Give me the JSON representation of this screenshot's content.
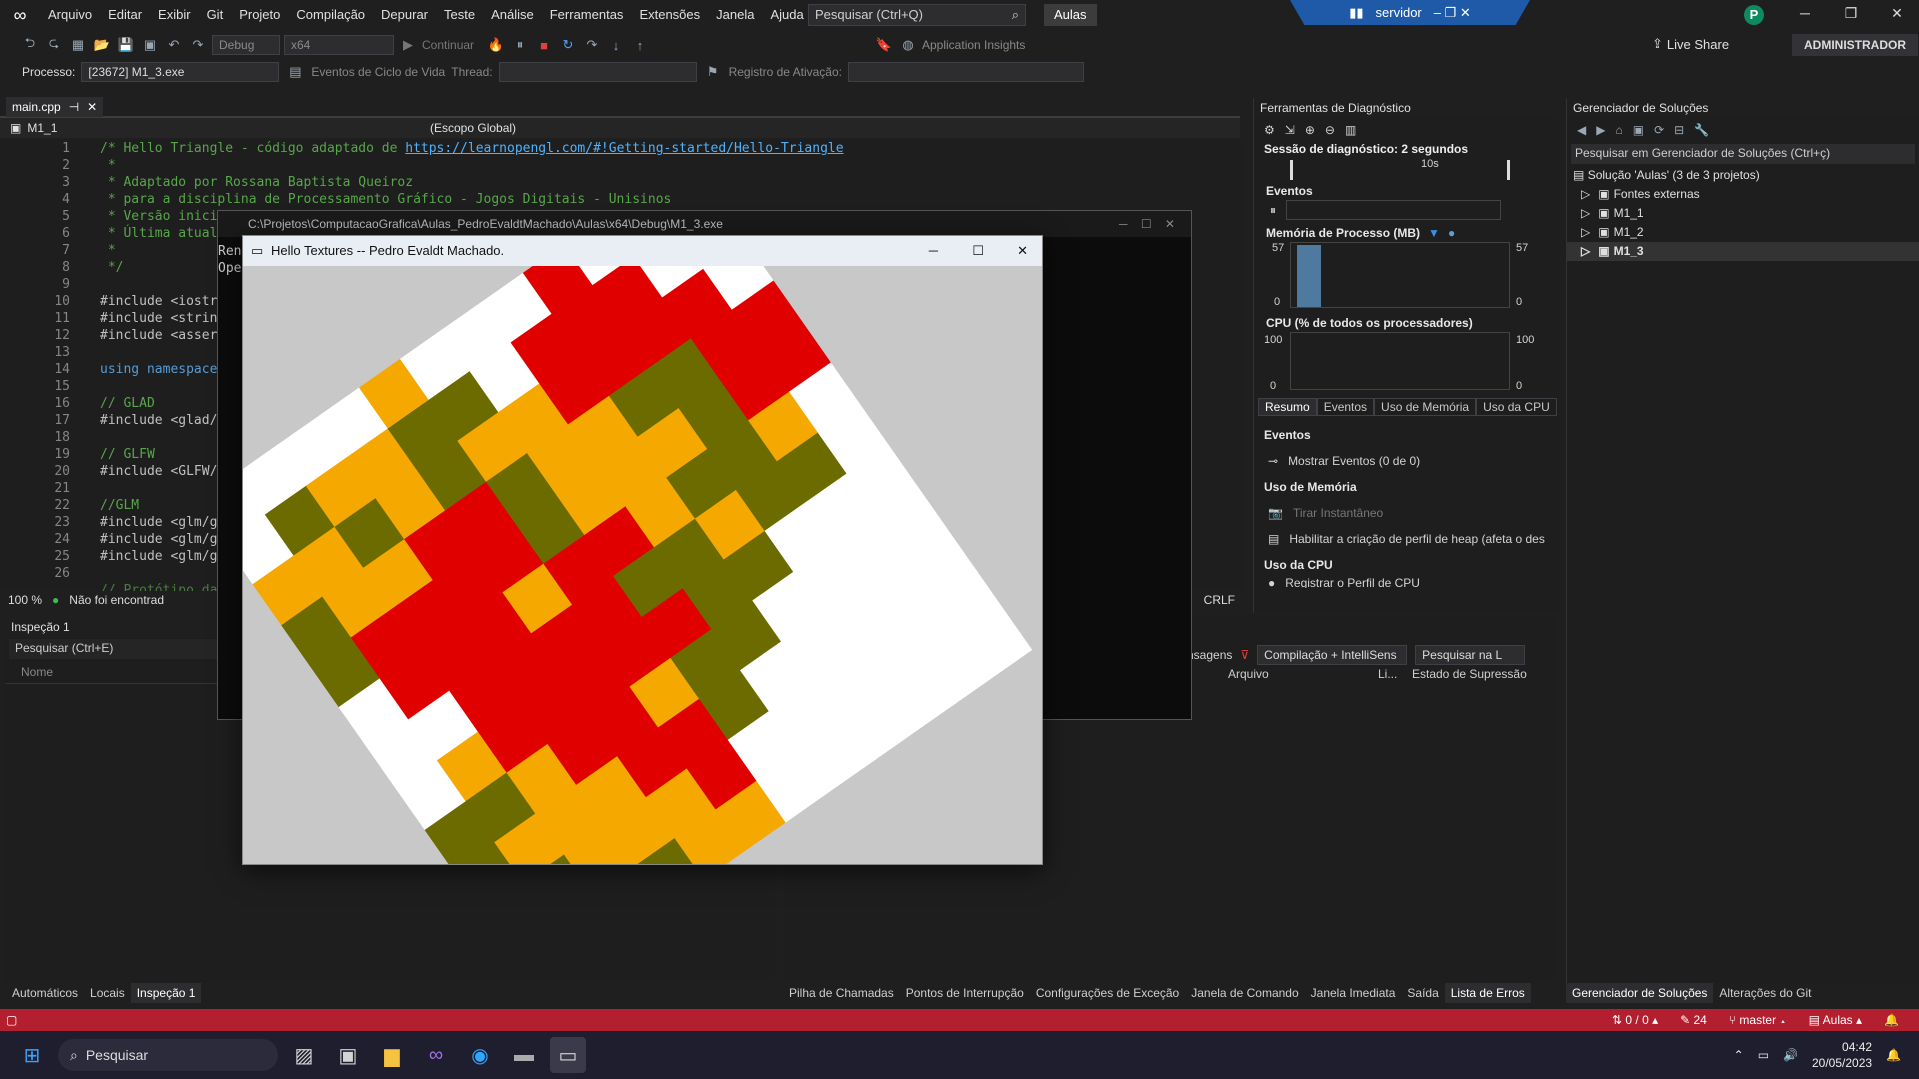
{
  "menubar": {
    "items": [
      "Arquivo",
      "Editar",
      "Exibir",
      "Git",
      "Projeto",
      "Compilação",
      "Depurar",
      "Teste",
      "Análise",
      "Ferramentas",
      "Extensões",
      "Janela",
      "Ajuda"
    ],
    "search_placeholder": "Pesquisar (Ctrl+Q)",
    "solution_name": "Aulas",
    "remote": "servidor",
    "avatar": "P"
  },
  "toolbar": {
    "config": "Debug",
    "platform": "x64",
    "continue": "Continuar",
    "app_insights": "Application Insights",
    "live_share": "Live Share",
    "admin": "ADMINISTRADOR",
    "process_label": "Processo:",
    "process_value": "[23672] M1_3.exe",
    "lifecycle": "Eventos de Ciclo de Vida",
    "thread_label": "Thread:",
    "activation_label": "Registro de Ativação:"
  },
  "editor": {
    "tab": "main.cpp",
    "project": "M1_1",
    "scope": "(Escopo Global)",
    "line_numbers": [
      "1",
      "2",
      "3",
      "4",
      "5",
      "6",
      "7",
      "8",
      "9",
      "10",
      "11",
      "12",
      "13",
      "14",
      "15",
      "16",
      "17",
      "18",
      "19",
      "20",
      "21",
      "22",
      "23",
      "24",
      "25",
      "26"
    ],
    "lines": [
      {
        "text": "/* Hello Triangle - código adaptado de ",
        "cls": "c-comment",
        "link": "https://learnopengl.com/#!Getting-started/Hello-Triangle"
      },
      {
        "text": " *",
        "cls": "c-comment"
      },
      {
        "text": " * Adaptado por Rossana Baptista Queiroz",
        "cls": "c-comment"
      },
      {
        "text": " * para a disciplina de Processamento Gráfico - Jogos Digitais - Unisinos",
        "cls": "c-comment"
      },
      {
        "text": " * Versão inici",
        "cls": "c-comment"
      },
      {
        "text": " * Última atual",
        "cls": "c-comment"
      },
      {
        "text": " *",
        "cls": "c-comment"
      },
      {
        "text": " */",
        "cls": "c-comment"
      },
      {
        "text": "",
        "cls": "c-pp"
      },
      {
        "text": "#include <iostr",
        "cls": "c-pp"
      },
      {
        "text": "#include <strin",
        "cls": "c-pp"
      },
      {
        "text": "#include <asser",
        "cls": "c-pp"
      },
      {
        "text": "",
        "cls": "c-pp"
      },
      {
        "text": "using namespace",
        "cls": "c-kw"
      },
      {
        "text": "",
        "cls": "c-pp"
      },
      {
        "text": "// GLAD",
        "cls": "c-comment"
      },
      {
        "text": "#include <glad/",
        "cls": "c-pp"
      },
      {
        "text": "",
        "cls": "c-pp"
      },
      {
        "text": "// GLFW",
        "cls": "c-comment"
      },
      {
        "text": "#include <GLFW/",
        "cls": "c-pp"
      },
      {
        "text": "",
        "cls": "c-pp"
      },
      {
        "text": "//GLM",
        "cls": "c-comment"
      },
      {
        "text": "#include <glm/g",
        "cls": "c-pp"
      },
      {
        "text": "#include <glm/g",
        "cls": "c-pp"
      },
      {
        "text": "#include <glm/g",
        "cls": "c-pp"
      },
      {
        "text": "",
        "cls": "c-pp"
      }
    ],
    "zoom": "100 %",
    "status_msg": "Não foi encontrad",
    "eol": "CRLF",
    "partial_line": "// Protótipo da"
  },
  "diagnostics": {
    "title": "Ferramentas de Diagnóstico",
    "session": "Sessão de diagnóstico: 2 segundos",
    "timeline_tick": "10s",
    "events_label": "Eventos",
    "memory_label": "Memória de Processo (MB)",
    "memory_max": "57",
    "memory_min": "0",
    "cpu_label": "CPU (% de todos os processadores)",
    "cpu_max": "100",
    "cpu_min": "0",
    "tabs": [
      "Resumo",
      "Eventos",
      "Uso de Memória",
      "Uso da CPU"
    ],
    "section_events": "Eventos",
    "show_events": "Mostrar Eventos (0 de 0)",
    "section_memory": "Uso de Memória",
    "snapshot": "Tirar Instantâneo",
    "heap": "Habilitar a criação de perfil de heap (afeta o des",
    "section_cpu": "Uso da CPU",
    "cpu_profile": "Registrar o Perfil de CPU"
  },
  "solution": {
    "title": "Gerenciador de Soluções",
    "search": "Pesquisar em Gerenciador de Soluções (Ctrl+ç)",
    "root": "Solução 'Aulas' (3 de 3 projetos)",
    "items": [
      "Fontes externas",
      "M1_1",
      "M1_2",
      "M1_3"
    ]
  },
  "watch": {
    "title": "Inspeção 1",
    "search": "Pesquisar (Ctrl+E)",
    "col_name": "Nome"
  },
  "errors": {
    "messages_tab": "nsagens",
    "filter": "Compilação + IntelliSens",
    "search": "Pesquisar na L",
    "col_file": "Arquivo",
    "col_line": "Li...",
    "col_state": "Estado de Supressão"
  },
  "console": {
    "title": "C:\\Projetos\\ComputacaoGrafica\\Aulas_PedroEvaldtMachado\\Aulas\\x64\\Debug\\M1_3.exe",
    "line1": "Ren",
    "line2": "Ope"
  },
  "glwindow": {
    "title": "Hello Textures -- Pedro Evaldt Machado."
  },
  "bottom_left_tabs": [
    "Automáticos",
    "Locais",
    "Inspeção 1"
  ],
  "bottom_mid_tabs": [
    "Pilha de Chamadas",
    "Pontos de Interrupção",
    "Configurações de Exceção",
    "Janela de Comando",
    "Janela Imediata",
    "Saída",
    "Lista de Erros"
  ],
  "bottom_right_tabs": [
    "Gerenciador de Soluções",
    "Alterações do Git"
  ],
  "statusbar": {
    "sync": "0 / 0",
    "edits": "24",
    "branch": "master",
    "repo": "Aulas"
  },
  "taskbar": {
    "search": "Pesquisar",
    "time": "04:42",
    "date": "20/05/2023"
  },
  "colors": {
    "accent": "#b31f2f",
    "pixel_red": "#e00000",
    "pixel_olive": "#6b6b00",
    "pixel_yellow": "#f5a800",
    "pixel_white": "#ffffff"
  }
}
